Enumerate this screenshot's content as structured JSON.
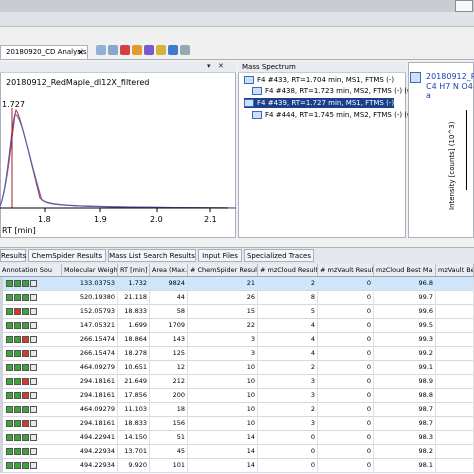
{
  "window": {
    "doc_tab": "20180920_CD Analysis"
  },
  "chromatogram": {
    "file": "20180912_RedMaple_dl12X_filtered",
    "peak_label": "1.727",
    "axis_label": "RT [min]",
    "ticks": [
      "1.8",
      "1.9",
      "2.0",
      "2.1"
    ],
    "controls": [
      "▾",
      "✕"
    ]
  },
  "mass_spectrum": {
    "title": "Mass Spectrum",
    "items": [
      {
        "text": "F4 #433, RT=1.704 min, MS1, FTMS (-)",
        "selected": false,
        "sub": false
      },
      {
        "text": "F4 #438, RT=1.723 min, MS2, FTMS (-) (CID,",
        "selected": false,
        "sub": true
      },
      {
        "text": "F4 #439, RT=1.727 min, MS1, FTMS (-)",
        "selected": true,
        "sub": false
      },
      {
        "text": "F4 #444, RT=1.745 min, MS2, FTMS (-) (CID,",
        "selected": false,
        "sub": true
      }
    ]
  },
  "spectrum": {
    "title": "20180912_Re",
    "formula": "C4 H7 N O4 a",
    "ylabel": "Intensity [counts] (10^3)"
  },
  "result_tabs": [
    "Results",
    "ChemSpider Results",
    "Mass List Search Results",
    "Input Files",
    "Specialized Traces"
  ],
  "grid": {
    "headers": [
      "Annotation Sou",
      "Molecular Weight",
      "RT [min]",
      "Area (Max.)",
      "# ChemSpider Results",
      "# mzCloud Results",
      "# mzVault Results",
      "mzCloud Best Ma",
      "mzVault Be"
    ],
    "rows": [
      {
        "annot": [
          "g",
          "g",
          "g",
          "w"
        ],
        "mw": "133.03753",
        "rt": "1.732",
        "area": "9824",
        "cs": "21",
        "mzc": "2",
        "mzv": "0",
        "best": "96.8"
      },
      {
        "annot": [
          "g",
          "g",
          "g",
          "w"
        ],
        "mw": "520.19380",
        "rt": "21.118",
        "area": "44",
        "cs": "26",
        "mzc": "8",
        "mzv": "0",
        "best": "99.7"
      },
      {
        "annot": [
          "g",
          "r",
          "g",
          "w"
        ],
        "mw": "152.05793",
        "rt": "18.833",
        "area": "58",
        "cs": "15",
        "mzc": "5",
        "mzv": "0",
        "best": "99.6"
      },
      {
        "annot": [
          "g",
          "g",
          "g",
          "w"
        ],
        "mw": "147.05321",
        "rt": "1.699",
        "area": "1709",
        "cs": "22",
        "mzc": "4",
        "mzv": "0",
        "best": "99.5"
      },
      {
        "annot": [
          "g",
          "g",
          "r",
          "w"
        ],
        "mw": "266.15474",
        "rt": "18.864",
        "area": "143",
        "cs": "3",
        "mzc": "4",
        "mzv": "0",
        "best": "99.3"
      },
      {
        "annot": [
          "g",
          "g",
          "r",
          "w"
        ],
        "mw": "266.15474",
        "rt": "18.278",
        "area": "125",
        "cs": "3",
        "mzc": "4",
        "mzv": "0",
        "best": "99.2"
      },
      {
        "annot": [
          "g",
          "g",
          "g",
          "w"
        ],
        "mw": "464.09279",
        "rt": "10.651",
        "area": "12",
        "cs": "10",
        "mzc": "2",
        "mzv": "0",
        "best": "99.1"
      },
      {
        "annot": [
          "g",
          "g",
          "r",
          "w"
        ],
        "mw": "294.18161",
        "rt": "21.649",
        "area": "212",
        "cs": "10",
        "mzc": "3",
        "mzv": "0",
        "best": "98.9"
      },
      {
        "annot": [
          "g",
          "g",
          "r",
          "w"
        ],
        "mw": "294.18161",
        "rt": "17.856",
        "area": "200",
        "cs": "10",
        "mzc": "3",
        "mzv": "0",
        "best": "98.8"
      },
      {
        "annot": [
          "g",
          "g",
          "g",
          "w"
        ],
        "mw": "464.09279",
        "rt": "11.103",
        "area": "18",
        "cs": "10",
        "mzc": "2",
        "mzv": "0",
        "best": "98.7"
      },
      {
        "annot": [
          "g",
          "g",
          "r",
          "w"
        ],
        "mw": "294.18161",
        "rt": "18.833",
        "area": "156",
        "cs": "10",
        "mzc": "3",
        "mzv": "0",
        "best": "98.7"
      },
      {
        "annot": [
          "g",
          "g",
          "g",
          "w"
        ],
        "mw": "494.22941",
        "rt": "14.150",
        "area": "51",
        "cs": "14",
        "mzc": "0",
        "mzv": "0",
        "best": "98.3"
      },
      {
        "annot": [
          "g",
          "g",
          "g",
          "w"
        ],
        "mw": "494.22934",
        "rt": "13.701",
        "area": "45",
        "cs": "14",
        "mzc": "0",
        "mzv": "0",
        "best": "98.2"
      },
      {
        "annot": [
          "g",
          "g",
          "g",
          "w"
        ],
        "mw": "494.22934",
        "rt": "9.920",
        "area": "101",
        "cs": "14",
        "mzc": "0",
        "mzv": "0",
        "best": "98.1"
      }
    ]
  },
  "colors": {
    "accent": "#1c3f8c",
    "green": "#3aa63a",
    "red": "#d83a2a",
    "row_select": "#cfe6fb"
  },
  "icons": [
    "window-restore-icon",
    "toolbar-icons",
    "spectrum-icon",
    "expand-icon"
  ]
}
